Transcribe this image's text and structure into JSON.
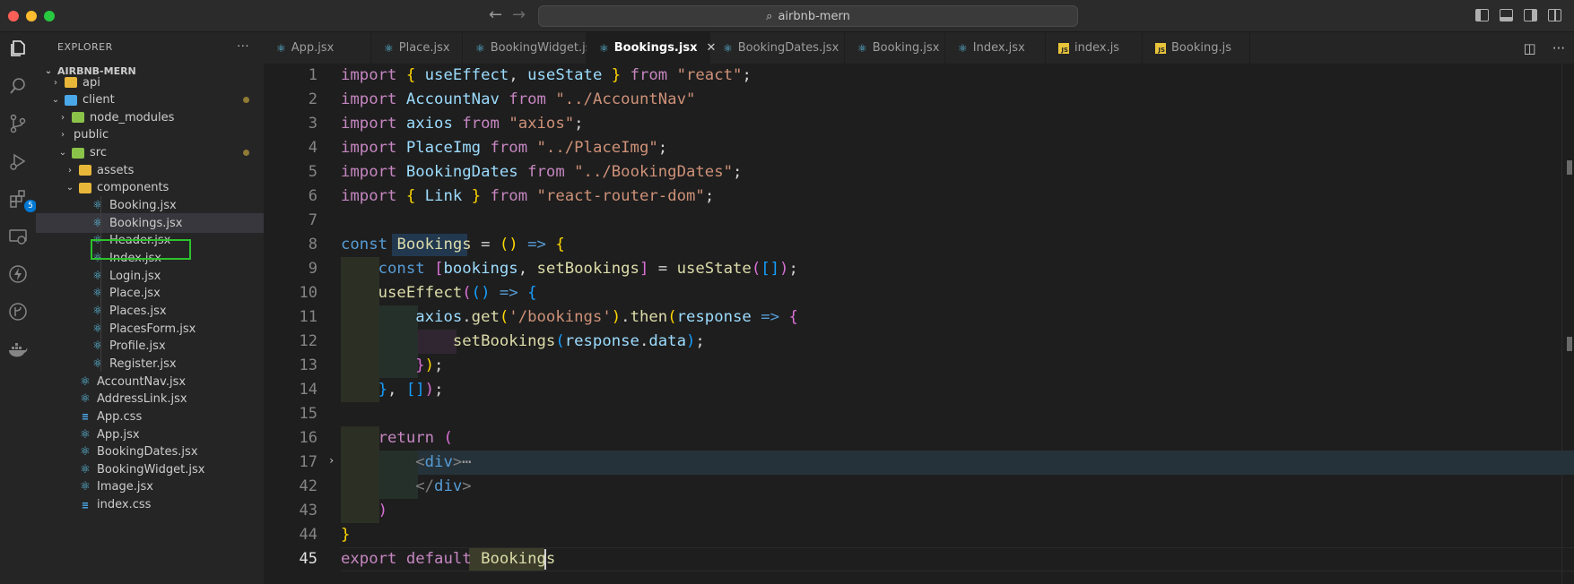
{
  "window": {
    "search_text": "airbnb-mern"
  },
  "activity_bar": {
    "extensions_badge": "5"
  },
  "explorer": {
    "title": "EXPLORER",
    "menu_glyph": "···",
    "root": "AIRBNB-MERN",
    "items": [
      {
        "label": "api",
        "depth": 1,
        "kind": "folder",
        "chevron": "right"
      },
      {
        "label": "client",
        "depth": 1,
        "kind": "folder-blue",
        "chevron": "down",
        "modified": true
      },
      {
        "label": "node_modules",
        "depth": 2,
        "kind": "folder-green",
        "chevron": "right"
      },
      {
        "label": "public",
        "depth": 2,
        "kind": "none",
        "chevron": "right"
      },
      {
        "label": "src",
        "depth": 2,
        "kind": "folder-green",
        "chevron": "down",
        "modified": true
      },
      {
        "label": "assets",
        "depth": 3,
        "kind": "folder",
        "chevron": "right"
      },
      {
        "label": "components",
        "depth": 3,
        "kind": "folder",
        "chevron": "down"
      },
      {
        "label": "Booking.jsx",
        "depth": 4,
        "kind": "react"
      },
      {
        "label": "Bookings.jsx",
        "depth": 4,
        "kind": "react",
        "selected": true
      },
      {
        "label": "Header.jsx",
        "depth": 4,
        "kind": "react"
      },
      {
        "label": "Index.jsx",
        "depth": 4,
        "kind": "react"
      },
      {
        "label": "Login.jsx",
        "depth": 4,
        "kind": "react"
      },
      {
        "label": "Place.jsx",
        "depth": 4,
        "kind": "react"
      },
      {
        "label": "Places.jsx",
        "depth": 4,
        "kind": "react"
      },
      {
        "label": "PlacesForm.jsx",
        "depth": 4,
        "kind": "react"
      },
      {
        "label": "Profile.jsx",
        "depth": 4,
        "kind": "react"
      },
      {
        "label": "Register.jsx",
        "depth": 4,
        "kind": "react"
      },
      {
        "label": "AccountNav.jsx",
        "depth": 3,
        "kind": "react"
      },
      {
        "label": "AddressLink.jsx",
        "depth": 3,
        "kind": "react"
      },
      {
        "label": "App.css",
        "depth": 3,
        "kind": "css"
      },
      {
        "label": "App.jsx",
        "depth": 3,
        "kind": "react"
      },
      {
        "label": "BookingDates.jsx",
        "depth": 3,
        "kind": "react"
      },
      {
        "label": "BookingWidget.jsx",
        "depth": 3,
        "kind": "react"
      },
      {
        "label": "Image.jsx",
        "depth": 3,
        "kind": "react"
      },
      {
        "label": "index.css",
        "depth": 3,
        "kind": "css"
      }
    ]
  },
  "tabs": [
    {
      "label": "App.jsx",
      "kind": "react"
    },
    {
      "label": "Place.jsx",
      "kind": "react"
    },
    {
      "label": "BookingWidget.jsx",
      "kind": "react"
    },
    {
      "label": "Bookings.jsx",
      "kind": "react",
      "active": true
    },
    {
      "label": "BookingDates.jsx",
      "kind": "react"
    },
    {
      "label": "Booking.jsx",
      "kind": "react"
    },
    {
      "label": "Index.jsx",
      "kind": "react"
    },
    {
      "label": "index.js",
      "kind": "js"
    },
    {
      "label": "Booking.js",
      "kind": "js"
    }
  ],
  "editor": {
    "line_numbers": [
      "1",
      "2",
      "3",
      "4",
      "5",
      "6",
      "7",
      "8",
      "9",
      "10",
      "11",
      "12",
      "13",
      "14",
      "15",
      "16",
      "17",
      "42",
      "43",
      "44",
      "45"
    ],
    "current_line": "45",
    "lines": [
      [
        [
          "k",
          "import"
        ],
        [
          "pl",
          " "
        ],
        [
          "br1",
          "{"
        ],
        [
          "pl",
          " "
        ],
        [
          "v",
          "useEffect"
        ],
        [
          "pl",
          ", "
        ],
        [
          "v",
          "useState"
        ],
        [
          "pl",
          " "
        ],
        [
          "br1",
          "}"
        ],
        [
          "pl",
          " "
        ],
        [
          "k",
          "from"
        ],
        [
          "pl",
          " "
        ],
        [
          "s",
          "\"react\""
        ],
        [
          "pl",
          ";"
        ]
      ],
      [
        [
          "k",
          "import"
        ],
        [
          "pl",
          " "
        ],
        [
          "v",
          "AccountNav"
        ],
        [
          "pl",
          " "
        ],
        [
          "k",
          "from"
        ],
        [
          "pl",
          " "
        ],
        [
          "s",
          "\"../AccountNav\""
        ]
      ],
      [
        [
          "k",
          "import"
        ],
        [
          "pl",
          " "
        ],
        [
          "v",
          "axios"
        ],
        [
          "pl",
          " "
        ],
        [
          "k",
          "from"
        ],
        [
          "pl",
          " "
        ],
        [
          "s",
          "\"axios\""
        ],
        [
          "pl",
          ";"
        ]
      ],
      [
        [
          "k",
          "import"
        ],
        [
          "pl",
          " "
        ],
        [
          "v",
          "PlaceImg"
        ],
        [
          "pl",
          " "
        ],
        [
          "k",
          "from"
        ],
        [
          "pl",
          " "
        ],
        [
          "s",
          "\"../PlaceImg\""
        ],
        [
          "pl",
          ";"
        ]
      ],
      [
        [
          "k",
          "import"
        ],
        [
          "pl",
          " "
        ],
        [
          "v",
          "BookingDates"
        ],
        [
          "pl",
          " "
        ],
        [
          "k",
          "from"
        ],
        [
          "pl",
          " "
        ],
        [
          "s",
          "\"../BookingDates\""
        ],
        [
          "pl",
          ";"
        ]
      ],
      [
        [
          "k",
          "import"
        ],
        [
          "pl",
          " "
        ],
        [
          "br1",
          "{"
        ],
        [
          "pl",
          " "
        ],
        [
          "v",
          "Link"
        ],
        [
          "pl",
          " "
        ],
        [
          "br1",
          "}"
        ],
        [
          "pl",
          " "
        ],
        [
          "k",
          "from"
        ],
        [
          "pl",
          " "
        ],
        [
          "s",
          "\"react-router-dom\""
        ],
        [
          "pl",
          ";"
        ]
      ],
      [],
      [
        [
          "kb",
          "const"
        ],
        [
          "pl",
          " "
        ],
        [
          "f",
          "Bookings"
        ],
        [
          "pl",
          " = "
        ],
        [
          "br1",
          "()"
        ],
        [
          "pl",
          " "
        ],
        [
          "kb",
          "=>"
        ],
        [
          "pl",
          " "
        ],
        [
          "br1",
          "{"
        ]
      ],
      [
        [
          "pl",
          "    "
        ],
        [
          "kb",
          "const"
        ],
        [
          "pl",
          " "
        ],
        [
          "br2",
          "["
        ],
        [
          "v",
          "bookings"
        ],
        [
          "pl",
          ", "
        ],
        [
          "f",
          "setBookings"
        ],
        [
          "br2",
          "]"
        ],
        [
          "pl",
          " = "
        ],
        [
          "f",
          "useState"
        ],
        [
          "br2",
          "("
        ],
        [
          "br3",
          "[]"
        ],
        [
          "br2",
          ")"
        ],
        [
          "pl",
          ";"
        ]
      ],
      [
        [
          "pl",
          "    "
        ],
        [
          "f",
          "useEffect"
        ],
        [
          "br2",
          "("
        ],
        [
          "br3",
          "()"
        ],
        [
          "pl",
          " "
        ],
        [
          "kb",
          "=>"
        ],
        [
          "pl",
          " "
        ],
        [
          "br3",
          "{"
        ]
      ],
      [
        [
          "pl",
          "        "
        ],
        [
          "v",
          "axios"
        ],
        [
          "pl",
          "."
        ],
        [
          "f",
          "get"
        ],
        [
          "br1",
          "("
        ],
        [
          "s",
          "'/bookings'"
        ],
        [
          "br1",
          ")"
        ],
        [
          "pl",
          "."
        ],
        [
          "f",
          "then"
        ],
        [
          "br1",
          "("
        ],
        [
          "v",
          "response"
        ],
        [
          "pl",
          " "
        ],
        [
          "kb",
          "=>"
        ],
        [
          "pl",
          " "
        ],
        [
          "br2",
          "{"
        ]
      ],
      [
        [
          "pl",
          "            "
        ],
        [
          "f",
          "setBookings"
        ],
        [
          "br3",
          "("
        ],
        [
          "v",
          "response"
        ],
        [
          "pl",
          "."
        ],
        [
          "v",
          "data"
        ],
        [
          "br3",
          ")"
        ],
        [
          "pl",
          ";"
        ]
      ],
      [
        [
          "pl",
          "        "
        ],
        [
          "br2",
          "}"
        ],
        [
          "br1",
          ")"
        ],
        [
          "pl",
          ";"
        ]
      ],
      [
        [
          "pl",
          "    "
        ],
        [
          "br3",
          "}"
        ],
        [
          "pl",
          ", "
        ],
        [
          "br3",
          "[]"
        ],
        [
          "br2",
          ")"
        ],
        [
          "pl",
          ";"
        ]
      ],
      [],
      [
        [
          "pl",
          "    "
        ],
        [
          "k",
          "return"
        ],
        [
          "pl",
          " "
        ],
        [
          "br2",
          "("
        ]
      ],
      [
        [
          "pl",
          "        "
        ],
        [
          "tg",
          "<"
        ],
        [
          "tn",
          "div"
        ],
        [
          "tg",
          ">"
        ],
        [
          "fold-dots",
          "⋯"
        ]
      ],
      [
        [
          "pl",
          "        "
        ],
        [
          "tg",
          "</"
        ],
        [
          "tn",
          "div"
        ],
        [
          "tg",
          ">"
        ]
      ],
      [
        [
          "pl",
          "    "
        ],
        [
          "br2",
          ")"
        ]
      ],
      [
        [
          "br1",
          "}"
        ]
      ],
      [
        [
          "k",
          "export"
        ],
        [
          "pl",
          " "
        ],
        [
          "k",
          "default"
        ],
        [
          "pl",
          " "
        ],
        [
          "f",
          "Bookings"
        ]
      ]
    ]
  }
}
